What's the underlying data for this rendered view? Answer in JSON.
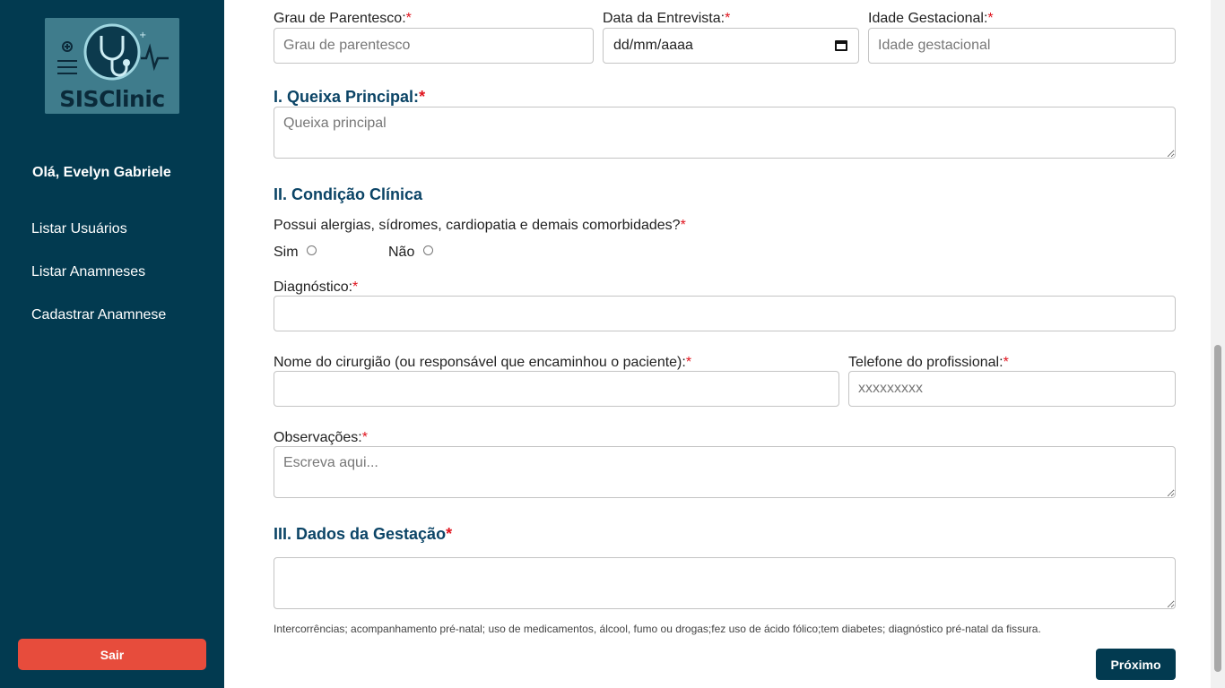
{
  "sidebar": {
    "logo_text": "SISClinic",
    "greeting": "Olá, Evelyn Gabriele",
    "nav": [
      "Listar Usuários",
      "Listar Anamneses",
      "Cadastrar Anamnese"
    ],
    "logout_label": "Sair"
  },
  "form": {
    "grau_label": "Grau de Parentesco:",
    "grau_placeholder": "Grau de parentesco",
    "data_label": "Data da Entrevista:",
    "data_value": "dd/mm/aaaa",
    "idade_label": "Idade Gestacional:",
    "idade_placeholder": "Idade gestacional",
    "queixa_title": "I. Queixa Principal:",
    "queixa_placeholder": "Queixa principal",
    "condicao_title": "II. Condição Clínica",
    "alergias_question": "Possui alergias, sídromes, cardiopatia e demais comorbidades?",
    "radio_sim": "Sim",
    "radio_nao": "Não",
    "diagnostico_label": "Diagnóstico:",
    "cirurgiao_label": "Nome do cirurgião (ou responsável que encaminhou o paciente):",
    "telefone_label": "Telefone do profissional:",
    "telefone_placeholder": "xxxxxxxxx",
    "observacoes_label": "Observações:",
    "observacoes_placeholder": "Escreva aqui...",
    "gestacao_title": "III. Dados da Gestação",
    "gestacao_hint": "Intercorrências; acompanhamento pré-natal; uso de medicamentos, álcool, fumo ou drogas;fez uso de ácido fólico;tem diabetes; diagnóstico pré-natal da fissura.",
    "required_mark": "*",
    "next_label": "Próximo"
  },
  "colors": {
    "sidebar_bg": "#023a50",
    "logout_bg": "#e74c3c",
    "section_title": "#0b4466",
    "required": "#e0141e"
  },
  "icons": [
    "stethoscope-logo",
    "calendar-icon"
  ]
}
